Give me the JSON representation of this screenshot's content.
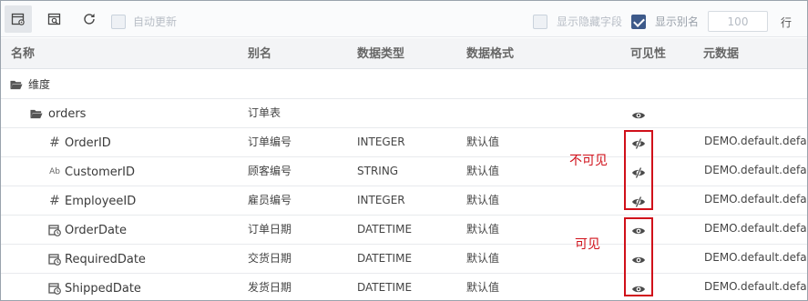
{
  "toolbar": {
    "auto_update_label": "自动更新",
    "show_hidden_label": "显示隐藏字段",
    "show_alias_label": "显示别名",
    "row_count_value": "100",
    "row_unit": "行",
    "accent_color": "#3d5a8a"
  },
  "table": {
    "headers": {
      "name": "名称",
      "alias": "别名",
      "data_type": "数据类型",
      "data_format": "数据格式",
      "visibility": "可见性",
      "metadata": "元数据"
    },
    "dimension_group": "维度",
    "table_folder": {
      "name": "orders",
      "alias": "订单表",
      "visibility_icon": "eye-icon"
    },
    "fields": [
      {
        "type_icon": "hash-icon",
        "name": "OrderID",
        "alias": "订单编号",
        "data_type": "INTEGER",
        "data_format": "默认值",
        "visibility_icon": "eye-slash-icon",
        "visible": false,
        "metadata": "DEMO.default.defau"
      },
      {
        "type_icon": "text-ab-icon",
        "name": "CustomerID",
        "alias": "顾客编号",
        "data_type": "STRING",
        "data_format": "默认值",
        "visibility_icon": "eye-slash-icon",
        "visible": false,
        "metadata": "DEMO.default.defau"
      },
      {
        "type_icon": "hash-icon",
        "name": "EmployeeID",
        "alias": "雇员编号",
        "data_type": "INTEGER",
        "data_format": "默认值",
        "visibility_icon": "eye-slash-icon",
        "visible": false,
        "metadata": "DEMO.default.defau"
      },
      {
        "type_icon": "calendar-clock-icon",
        "name": "OrderDate",
        "alias": "订单日期",
        "data_type": "DATETIME",
        "data_format": "默认值",
        "visibility_icon": "eye-icon",
        "visible": true,
        "metadata": "DEMO.default.defau"
      },
      {
        "type_icon": "calendar-clock-icon",
        "name": "RequiredDate",
        "alias": "交货日期",
        "data_type": "DATETIME",
        "data_format": "默认值",
        "visibility_icon": "eye-icon",
        "visible": true,
        "metadata": "DEMO.default.defau"
      },
      {
        "type_icon": "calendar-clock-icon",
        "name": "ShippedDate",
        "alias": "发货日期",
        "data_type": "DATETIME",
        "data_format": "默认值",
        "visibility_icon": "eye-icon",
        "visible": true,
        "metadata": "DEMO.default.defau"
      }
    ]
  },
  "annotations": {
    "invisible_label": "不可见",
    "visible_label": "可见",
    "color": "#d0101a"
  }
}
